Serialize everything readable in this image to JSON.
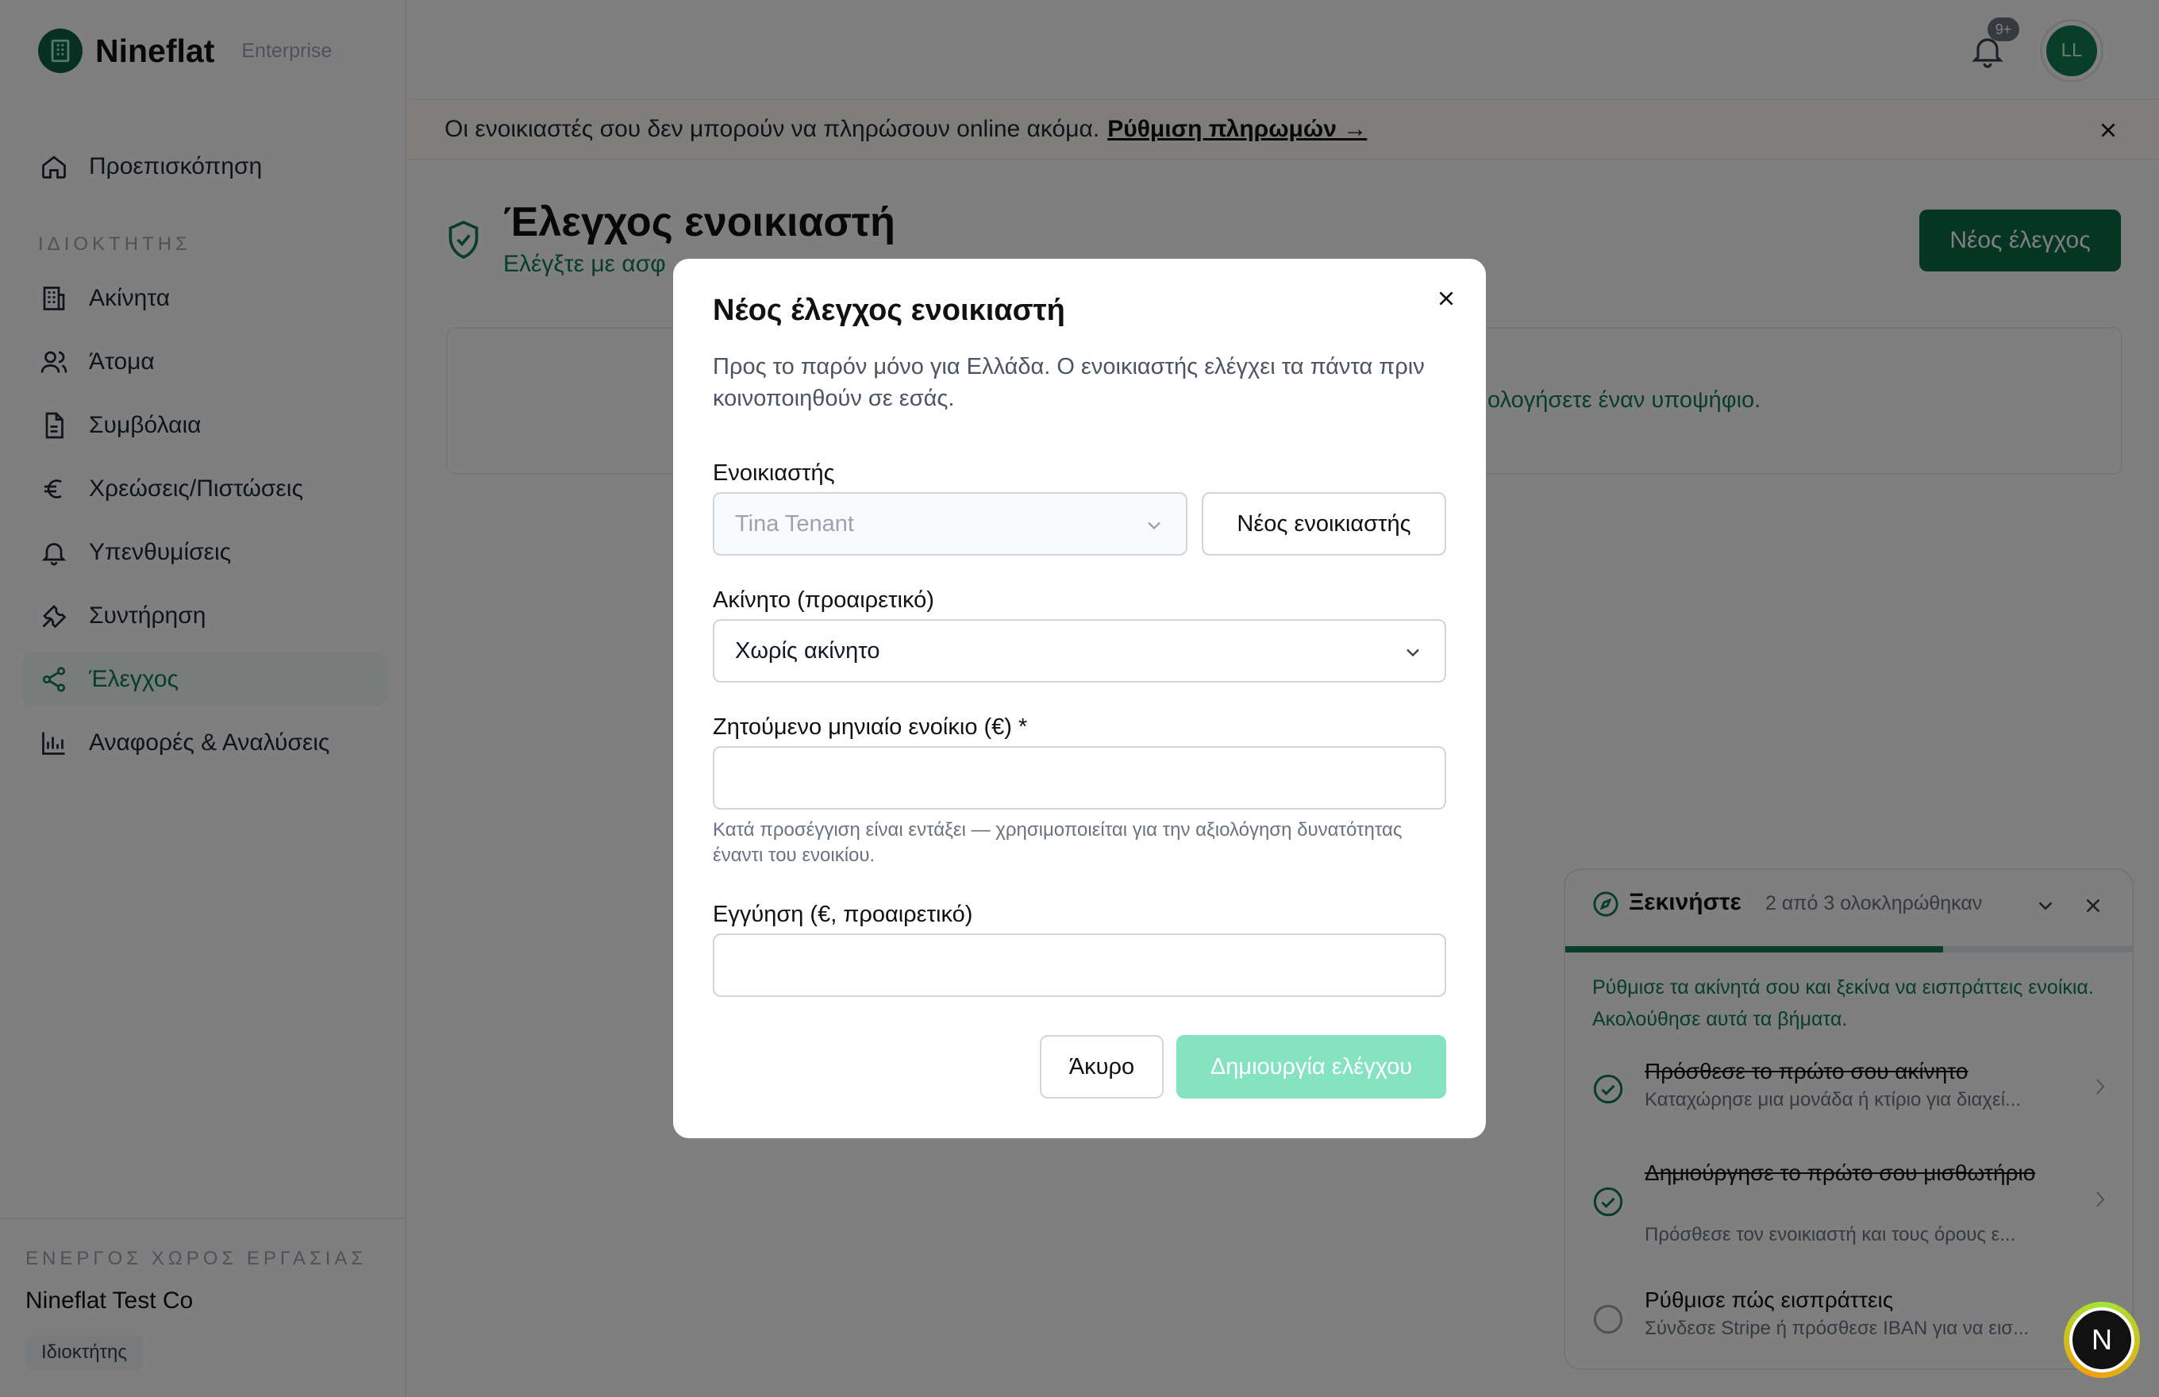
{
  "brand": {
    "name": "Nineflat",
    "plan": "Enterprise"
  },
  "sidebar": {
    "section_owner": "ΙΔΙΟΚΤΗΤΗΣ",
    "items": [
      {
        "label": "Προεπισκόπηση",
        "icon": "home-icon"
      },
      {
        "label": "Ακίνητα",
        "icon": "building-icon"
      },
      {
        "label": "Άτομα",
        "icon": "users-icon"
      },
      {
        "label": "Συμβόλαια",
        "icon": "document-icon"
      },
      {
        "label": "Χρεώσεις/Πιστώσεις",
        "icon": "euro-icon"
      },
      {
        "label": "Υπενθυμίσεις",
        "icon": "bell-icon"
      },
      {
        "label": "Συντήρηση",
        "icon": "wrench-icon"
      },
      {
        "label": "Έλεγχος",
        "icon": "share-icon",
        "active": true
      },
      {
        "label": "Αναφορές & Αναλύσεις",
        "icon": "bar-chart-icon"
      }
    ],
    "workspace_label": "ΕΝΕΡΓΟΣ ΧΩΡΟΣ ΕΡΓΑΣΙΑΣ",
    "workspace_name": "Nineflat Test Co",
    "workspace_role": "Ιδιοκτήτης"
  },
  "topbar": {
    "notification_badge": "9+",
    "avatar_initials": "LL"
  },
  "banner": {
    "text": "Οι ενοικιαστές σου δεν μπορούν να πληρώσουν online ακόμα.",
    "link": "Ρύθμιση πληρωμών →"
  },
  "page": {
    "title": "Έλεγχος ενοικιαστή",
    "subtitle": "Ελέγξτε με ασφ",
    "new_button": "Νέος έλεγχος",
    "empty_text": "ολογήσετε έναν υποψήφιο."
  },
  "onboarding": {
    "title": "Ξεκινήστε",
    "count": "2 από 3 ολοκληρώθηκαν",
    "progress": 0.667,
    "description": "Ρύθμισε τα ακίνητά σου και ξεκίνα να εισπράττεις ενοίκια. Ακολούθησε αυτά τα βήματα.",
    "steps": [
      {
        "title": "Πρόσθεσε το πρώτο σου ακίνητο",
        "desc": "Καταχώρησε μια μονάδα ή κτίριο για διαχεί...",
        "done": true
      },
      {
        "title": "Δημιούργησε το πρώτο σου μισθωτήριο",
        "desc": "Πρόσθεσε τον ενοικιαστή και τους όρους ε...",
        "done": true
      },
      {
        "title": "Ρύθμισε πώς εισπράττεις",
        "desc": "Σύνδεσε Stripe ή πρόσθεσε IBAN για να εισ...",
        "done": false
      }
    ]
  },
  "floating_button": "N",
  "modal": {
    "title": "Νέος έλεγχος ενοικιαστή",
    "description": "Προς το παρόν μόνο για Ελλάδα. Ο ενοικιαστής ελέγχει τα πάντα πριν κοινοποιηθούν σε εσάς.",
    "tenant_label": "Ενοικιαστής",
    "tenant_value": "Tina Tenant",
    "new_tenant_button": "Νέος ενοικιαστής",
    "property_label": "Ακίνητο (προαιρετικό)",
    "property_value": "Χωρίς ακίνητο",
    "rent_label": "Ζητούμενο μηνιαίο ενοίκιο (€) *",
    "rent_value": "",
    "rent_help": "Κατά προσέγγιση είναι εντάξει — χρησιμοποιείται για την αξιολόγηση δυνατότητας έναντι του ενοικίου.",
    "deposit_label": "Εγγύηση (€, προαιρετικό)",
    "deposit_value": "",
    "cancel_button": "Άκυρο",
    "submit_button": "Δημιουργία ελέγχου"
  },
  "colors": {
    "brand": "#0f5f44",
    "accent": "#0f7a52",
    "primary_disabled": "#86e3c1",
    "overlay": "rgba(0,0,0,0.5)"
  }
}
